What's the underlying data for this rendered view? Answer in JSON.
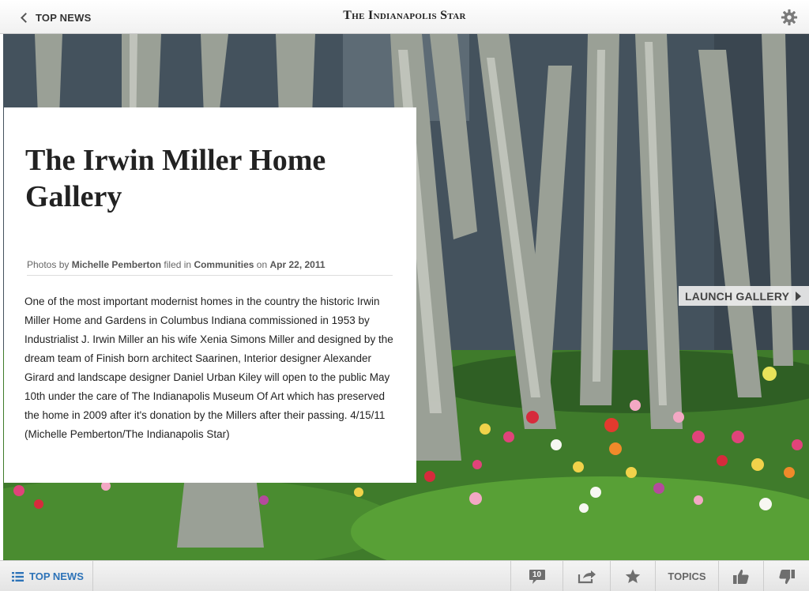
{
  "topbar": {
    "back_label": "TOP NEWS",
    "masthead": "The Indianapolis Star"
  },
  "article": {
    "title": "The Irwin Miller Home Gallery",
    "byline": {
      "photos_by_prefix": "Photos by ",
      "author": "Michelle Pemberton",
      "filed_in_text": " filed in ",
      "category": "Communities",
      "on_text": " on ",
      "date": "Apr 22, 2011"
    },
    "body": "One of the most important modernist homes in the country the historic Irwin Miller Home and Gardens in Columbus Indiana commissioned in 1953 by Industrialist J. Irwin Miller an his wife Xenia Simons Miller and designed by the dream team of Finish born architect Saarinen, Interior designer Alexander Girard and landscape designer Daniel Urban Kiley will open to the public May 10th under the care of The Indianapolis Museum Of Art which has preserved the home in 2009 after it's donation by the Millers after their passing. 4/15/11 (Michelle Pemberton/The Indianapolis Star)"
  },
  "gallery": {
    "launch_label": "LAUNCH GALLERY"
  },
  "bottombar": {
    "section_label": "TOP NEWS",
    "comment_count": "10",
    "topics_label": "TOPICS"
  },
  "icons": {
    "back": "chevron-left-icon",
    "settings": "gear-icon",
    "list": "list-icon",
    "comments": "comment-bubble-icon",
    "share": "share-icon",
    "favorite": "star-icon",
    "like": "thumbs-up-icon",
    "dislike": "thumbs-down-icon"
  },
  "colors": {
    "accent_blue": "#2d73b8",
    "toolbar_bg": "#ececec"
  }
}
